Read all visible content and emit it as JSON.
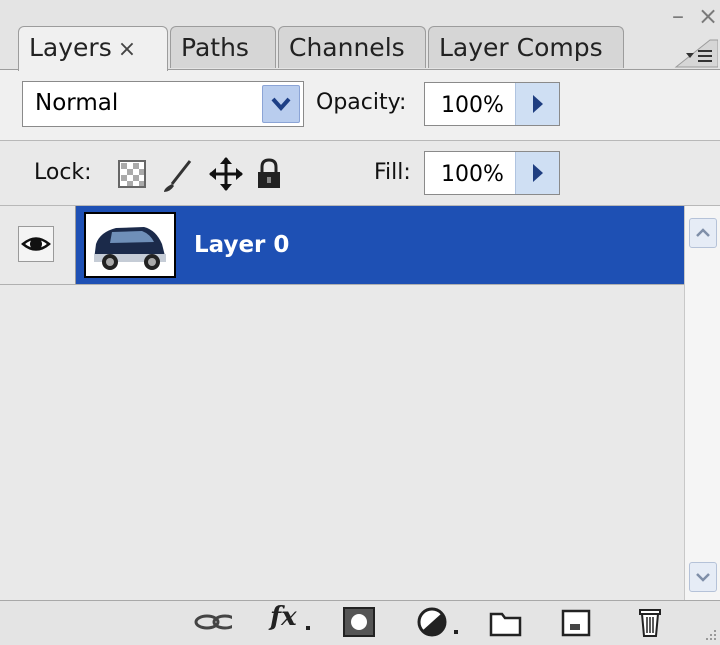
{
  "window": {
    "minimize_glyph": "–",
    "close_glyph": "×"
  },
  "tabs": [
    {
      "label": "Layers",
      "active": true,
      "close_glyph": "×"
    },
    {
      "label": "Paths"
    },
    {
      "label": "Channels"
    },
    {
      "label": "Layer Comps"
    }
  ],
  "blend_mode": {
    "value": "Normal"
  },
  "opacity": {
    "label": "Opacity:",
    "value": "100%"
  },
  "lock": {
    "label": "Lock:"
  },
  "fill": {
    "label": "Fill:",
    "value": "100%"
  },
  "layers": [
    {
      "name": "Layer 0",
      "selected": true,
      "visible": true
    }
  ],
  "colors": {
    "selection": "#1e50b4",
    "panel_bg": "#e9e9e9"
  },
  "icons": {
    "panel_menu": "panel-menu-icon",
    "blend_dropdown": "chevron-down-icon",
    "opacity_arrow": "triangle-right-icon",
    "fill_arrow": "triangle-right-icon",
    "lock_transparent": "lock-transparent-pixels-icon",
    "lock_image": "lock-image-pixels-icon",
    "lock_position": "lock-position-icon",
    "lock_all": "lock-all-icon",
    "visibility": "eye-icon",
    "link": "link-layers-icon",
    "fx": "fx-icon",
    "mask": "add-mask-icon",
    "adjustment": "adjustment-layer-icon",
    "group": "folder-icon",
    "new_layer": "new-layer-icon",
    "delete": "trash-icon"
  },
  "bottom": {
    "fx_label": "fx"
  }
}
